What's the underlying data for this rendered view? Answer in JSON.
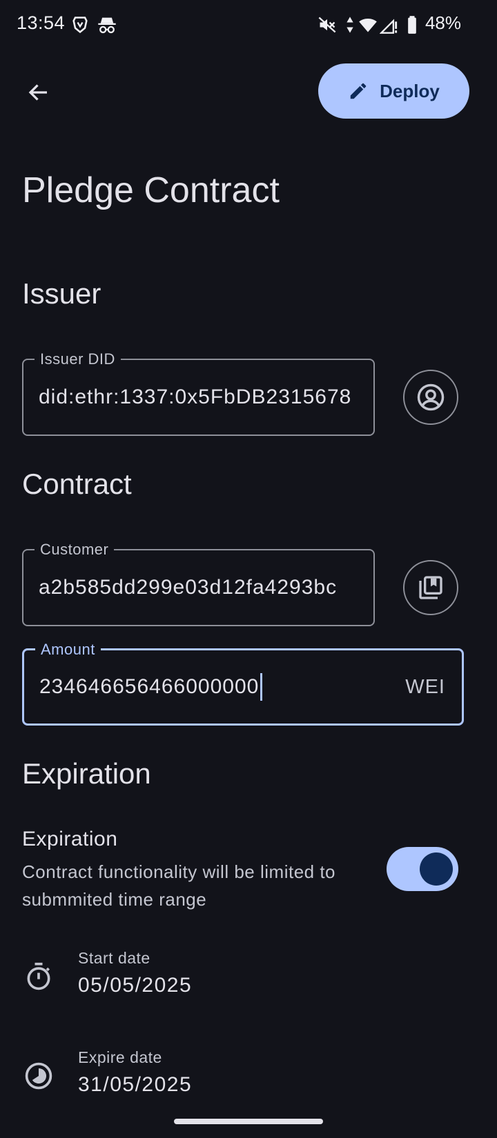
{
  "status_bar": {
    "time": "13:54",
    "battery": "48%",
    "icons": [
      "brave-icon",
      "incognito-icon",
      "mute-icon",
      "data-arrows-icon",
      "wifi-icon",
      "signal-icon",
      "battery-icon"
    ]
  },
  "app_bar": {
    "back_icon": "arrow-back-icon",
    "deploy_label": "Deploy",
    "deploy_icon": "pencil-icon"
  },
  "page": {
    "title": "Pledge Contract"
  },
  "issuer": {
    "section_title": "Issuer",
    "did_label": "Issuer DID",
    "did_value": "did:ethr:1337:0x5FbDB2315678",
    "action_icon": "account-circle-icon"
  },
  "contract": {
    "section_title": "Contract",
    "customer_label": "Customer",
    "customer_value": "a2b585dd299e03d12fa4293bc",
    "customer_action_icon": "library-books-icon",
    "amount_label": "Amount",
    "amount_value": "234646656466000000",
    "amount_suffix": "WEI"
  },
  "expiration": {
    "section_title": "Expiration",
    "toggle_title": "Expiration",
    "toggle_description": "Contract functionality will be limited to submmited time range",
    "toggle_on": true,
    "start_label": "Start date",
    "start_value": "05/05/2025",
    "start_icon": "timer-icon",
    "expire_label": "Expire date",
    "expire_value": "31/05/2025",
    "expire_icon": "clock-pie-icon"
  },
  "colors": {
    "background": "#12131a",
    "primary": "#aec6ff",
    "on_primary": "#0f2b59",
    "outline": "#8e9099"
  }
}
